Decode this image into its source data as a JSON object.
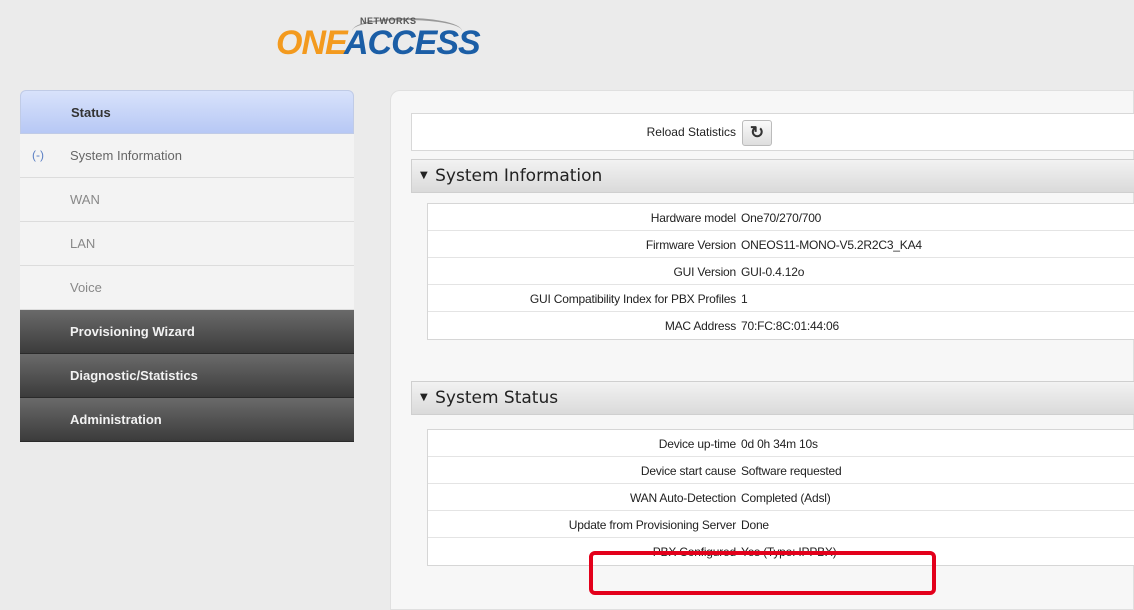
{
  "logo": {
    "networks": "NETWORKS",
    "one": "ONE",
    "access": "ACCESS"
  },
  "sidebar": {
    "active": "Status",
    "collapse": "(-)",
    "sub_items": [
      "System Information",
      "WAN",
      "LAN",
      "Voice"
    ],
    "sections": [
      "Provisioning Wizard",
      "Diagnostic/Statistics",
      "Administration"
    ]
  },
  "main": {
    "reload_label": "Reload Statistics",
    "reload_icon": "refresh-icon",
    "system_information": {
      "title": "System Information",
      "rows": [
        {
          "key": "Hardware model",
          "value": "One70/270/700"
        },
        {
          "key": "Firmware Version",
          "value": "ONEOS11-MONO-V5.2R2C3_KA4"
        },
        {
          "key": "GUI Version",
          "value": "GUI-0.4.12o"
        },
        {
          "key": "GUI Compatibility Index for PBX Profiles",
          "value": "1"
        },
        {
          "key": "MAC Address",
          "value": "70:FC:8C:01:44:06"
        }
      ]
    },
    "system_status": {
      "title": "System Status",
      "rows": [
        {
          "key": "Device up-time",
          "value": "0d 0h 34m 10s"
        },
        {
          "key": "Device start cause",
          "value": "Software requested"
        },
        {
          "key": "WAN Auto-Detection",
          "value": "Completed (Adsl)"
        },
        {
          "key": "Update from Provisioning Server",
          "value": "Done"
        },
        {
          "key": "PBX Configured",
          "value": "Yes (Type: IPPBX)"
        }
      ]
    }
  },
  "colors": {
    "highlight": "#e3001b",
    "logo_orange": "#f39a1e",
    "logo_blue": "#1b5ea6"
  }
}
